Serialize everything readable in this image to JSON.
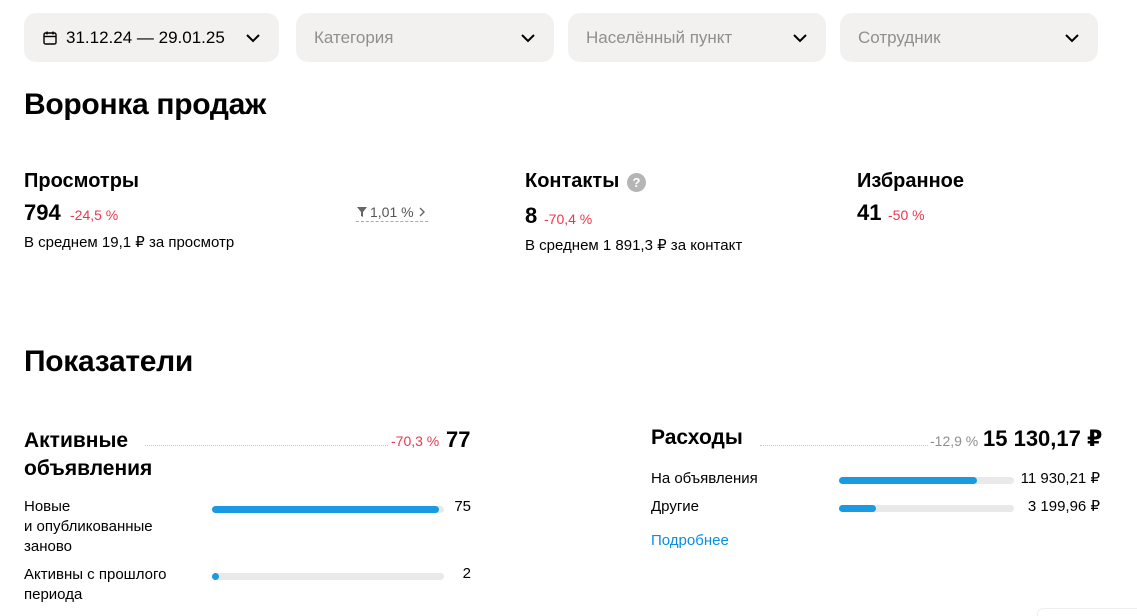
{
  "filters": {
    "date": "31.12.24 — 29.01.25",
    "category": "Категория",
    "city": "Населённый пункт",
    "employee": "Сотрудник"
  },
  "funnel": {
    "title": "Воронка продаж",
    "views": {
      "label": "Просмотры",
      "value": "794",
      "delta": "-24,5 %",
      "avg": "В среднем 19,1 ₽ за просмотр",
      "conversion": "1,01 %"
    },
    "contacts": {
      "label": "Контакты",
      "help": "?",
      "value": "8",
      "delta": "-70,4 %",
      "avg": "В среднем 1 891,3 ₽ за контакт"
    },
    "favorites": {
      "label": "Избранное",
      "value": "41",
      "delta": "-50 %"
    }
  },
  "metrics": {
    "title": "Показатели",
    "active": {
      "label_line1": "Активные",
      "label_line2": "объявления",
      "delta": "-70,3 %",
      "value": "77",
      "rows": [
        {
          "label_lines": [
            "Новые",
            "и опубликованные",
            "заново"
          ],
          "value": "75",
          "fraction": 0.98
        },
        {
          "label_lines": [
            "Активны с прошлого",
            "периода"
          ],
          "value": "2",
          "fraction": 0.026
        }
      ]
    },
    "expenses": {
      "label": "Расходы",
      "delta": "-12,9 %",
      "value": "15 130,17 ₽",
      "rows": [
        {
          "label": "На объявления",
          "value": "11 930,21 ₽",
          "fraction": 0.79
        },
        {
          "label": "Другие",
          "value": "3 199,96 ₽",
          "fraction": 0.21
        }
      ],
      "more_link": "Подробнее"
    }
  },
  "colors": {
    "accent": "#1a9ae0",
    "negative": "#e8384f",
    "muted": "#8f8f8f",
    "filter_bg": "#f2f1f0"
  }
}
